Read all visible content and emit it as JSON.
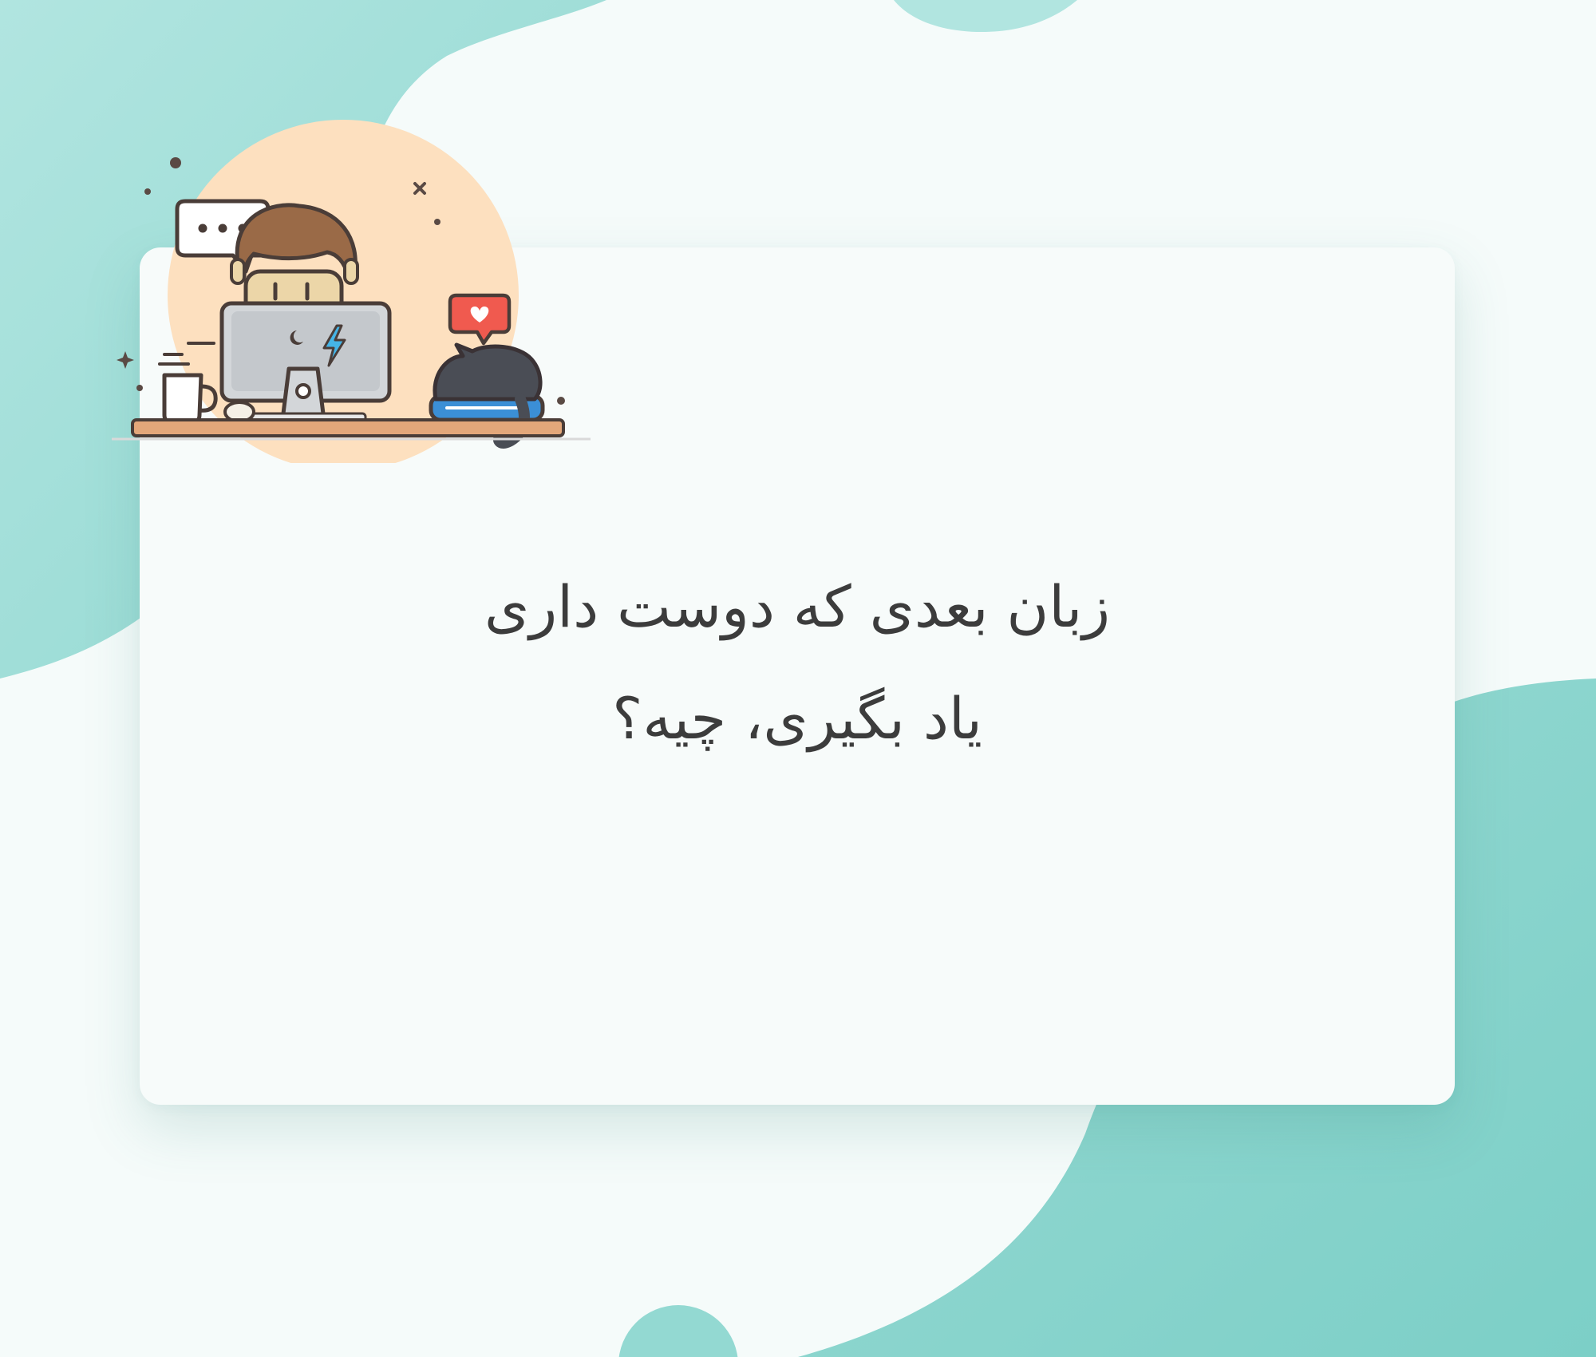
{
  "question": {
    "line1": "زبان بعدی که دوست داری",
    "line2": "یاد بگیری، چیه؟"
  },
  "colors": {
    "background": "#f5fbfa",
    "blob": "#a9e2dd",
    "blob_dark": "#7fd1ca",
    "card": "#f7fbfa",
    "text": "#3c3c3c",
    "illustration_circle": "#fde0bf"
  },
  "illustration": {
    "icons": [
      "chat-bubble-icon",
      "heart-notification-icon",
      "laptop-icon",
      "coffee-cup-icon",
      "cat-icon",
      "book-icon",
      "person-icon"
    ]
  }
}
